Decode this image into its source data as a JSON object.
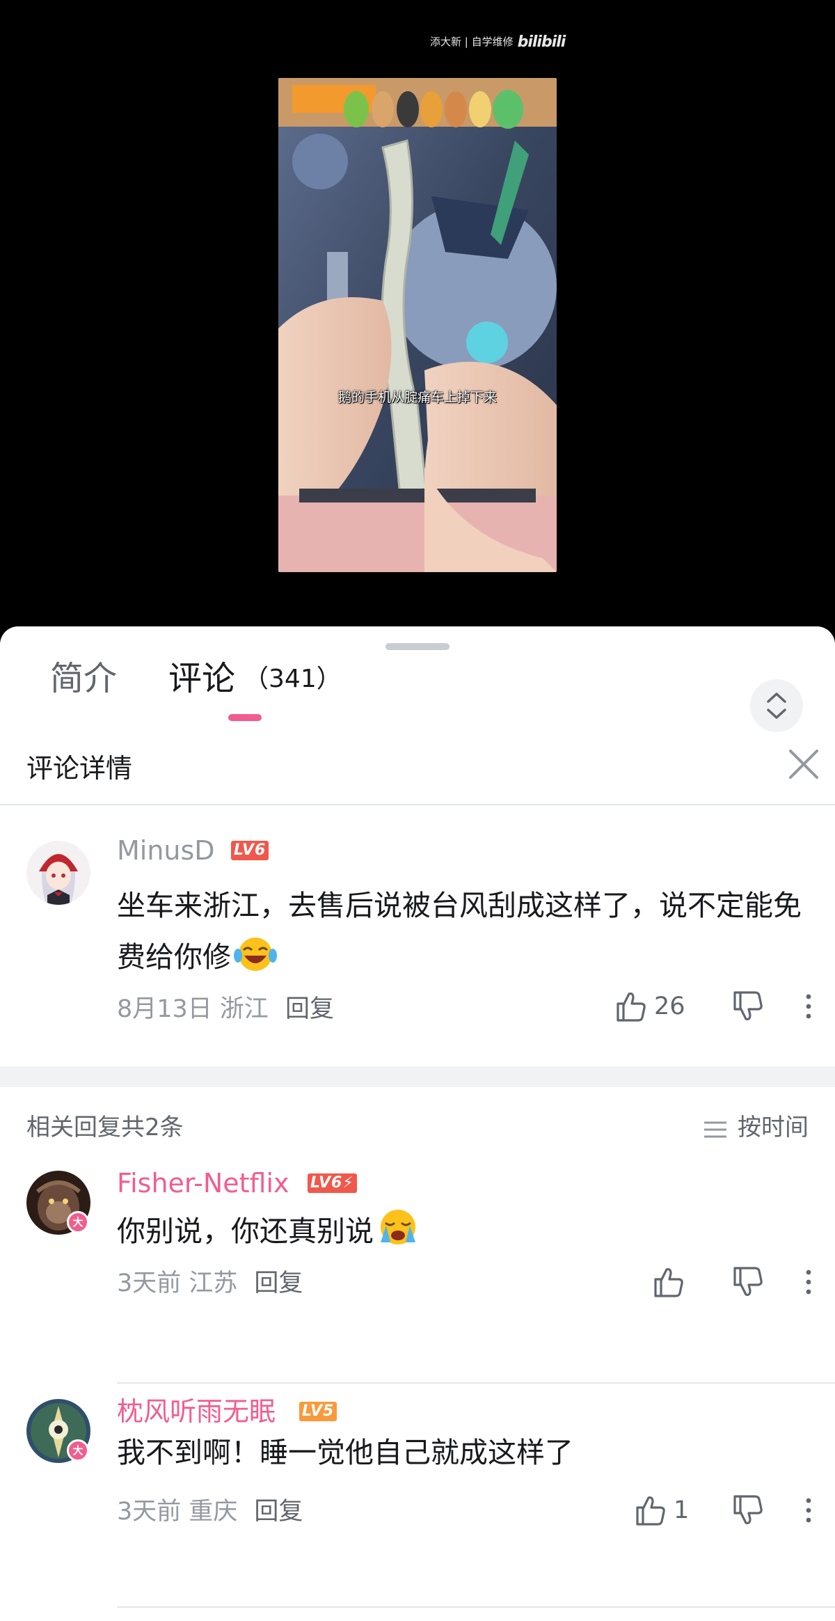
{
  "video": {
    "watermark_text": "添大新 | 自学维修",
    "watermark_logo": "bilibili",
    "subtitle": "鹅的手机从腚痛车上掉下来"
  },
  "tabs": {
    "intro_label": "简介",
    "comments_label": "评论",
    "comments_count": "（341）"
  },
  "detail": {
    "title": "评论详情"
  },
  "main_comment": {
    "username": "MinusD",
    "level": "LV6",
    "content": "坐车来浙江，去售后说被台风刮成这样了，说不定能免费给你修",
    "emoji": "laughing-tears-emoji",
    "date_location": "8月13日 浙江",
    "reply_label": "回复",
    "likes": "26"
  },
  "related": {
    "count_label": "相关回复共2条",
    "sort_label": "按时间"
  },
  "replies": [
    {
      "username": "Fisher-Netflix",
      "level": "LV6⚡",
      "badge": "大",
      "content": "你别说，你还真别说",
      "emoji": "crying-face-emoji",
      "date_location": "3天前 江苏",
      "reply_label": "回复",
      "likes": ""
    },
    {
      "username": "枕风听雨无眠",
      "level": "LV5",
      "badge": "大",
      "content": "我不到啊！睡一觉他自己就成这样了",
      "date_location": "3天前 重庆",
      "reply_label": "回复",
      "likes": "1"
    }
  ],
  "colors": {
    "accent_pink": "#f25d8e",
    "level_red": "#f0584b",
    "level_orange": "#f89a3c",
    "text_gray": "#9499a0"
  }
}
